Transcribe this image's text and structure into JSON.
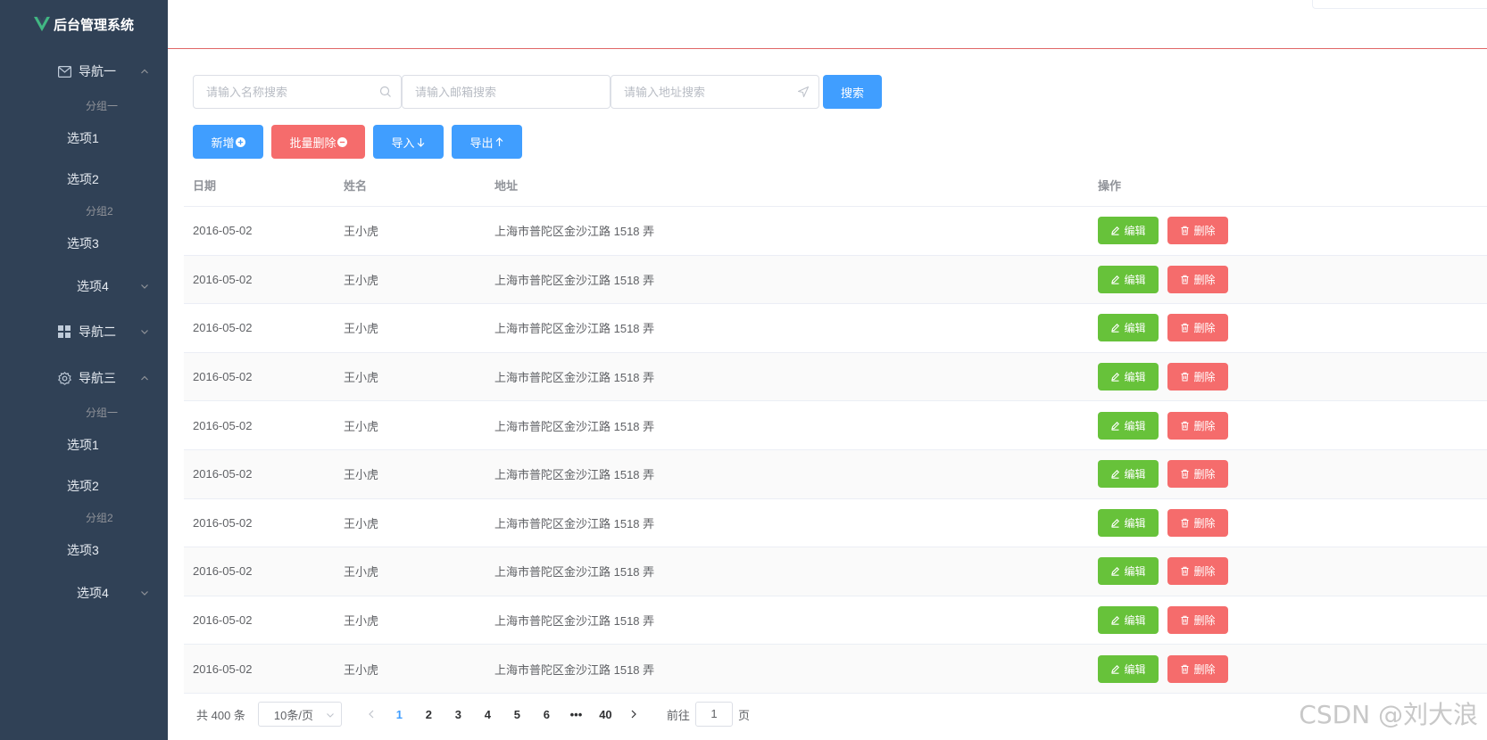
{
  "app": {
    "title": "后台管理系统"
  },
  "sidebar": {
    "nav1": {
      "label": "导航一",
      "groups": [
        {
          "title": "分组一",
          "items": [
            "选项1",
            "选项2"
          ]
        },
        {
          "title": "分组2",
          "items": [
            "选项3"
          ]
        }
      ],
      "submenu": "选项4"
    },
    "nav2": {
      "label": "导航二"
    },
    "nav3": {
      "label": "导航三",
      "groups": [
        {
          "title": "分组一",
          "items": [
            "选项1",
            "选项2"
          ]
        },
        {
          "title": "分组2",
          "items": [
            "选项3"
          ]
        }
      ],
      "submenu": "选项4"
    }
  },
  "search": {
    "name_placeholder": "请输入名称搜索",
    "email_placeholder": "请输入邮箱搜索",
    "address_placeholder": "请输入地址搜索",
    "button": "搜索"
  },
  "actions": {
    "add": "新增",
    "batch_delete": "批量删除",
    "import": "导入",
    "export": "导出"
  },
  "table": {
    "headers": {
      "date": "日期",
      "name": "姓名",
      "address": "地址",
      "ops": "操作"
    },
    "edit_label": "编辑",
    "delete_label": "删除",
    "rows": [
      {
        "date": "2016-05-02",
        "name": "王小虎",
        "address": "上海市普陀区金沙江路 1518 弄"
      },
      {
        "date": "2016-05-02",
        "name": "王小虎",
        "address": "上海市普陀区金沙江路 1518 弄"
      },
      {
        "date": "2016-05-02",
        "name": "王小虎",
        "address": "上海市普陀区金沙江路 1518 弄"
      },
      {
        "date": "2016-05-02",
        "name": "王小虎",
        "address": "上海市普陀区金沙江路 1518 弄"
      },
      {
        "date": "2016-05-02",
        "name": "王小虎",
        "address": "上海市普陀区金沙江路 1518 弄"
      },
      {
        "date": "2016-05-02",
        "name": "王小虎",
        "address": "上海市普陀区金沙江路 1518 弄"
      },
      {
        "date": "2016-05-02",
        "name": "王小虎",
        "address": "上海市普陀区金沙江路 1518 弄"
      },
      {
        "date": "2016-05-02",
        "name": "王小虎",
        "address": "上海市普陀区金沙江路 1518 弄"
      },
      {
        "date": "2016-05-02",
        "name": "王小虎",
        "address": "上海市普陀区金沙江路 1518 弄"
      },
      {
        "date": "2016-05-02",
        "name": "王小虎",
        "address": "上海市普陀区金沙江路 1518 弄"
      }
    ]
  },
  "pagination": {
    "total": "共 400 条",
    "page_size": "10条/页",
    "pages": [
      "1",
      "2",
      "3",
      "4",
      "5",
      "6",
      "•••",
      "40"
    ],
    "current": "1",
    "goto_prefix": "前往",
    "goto_value": "1",
    "goto_suffix": "页"
  },
  "watermark": "CSDN @刘大浪"
}
